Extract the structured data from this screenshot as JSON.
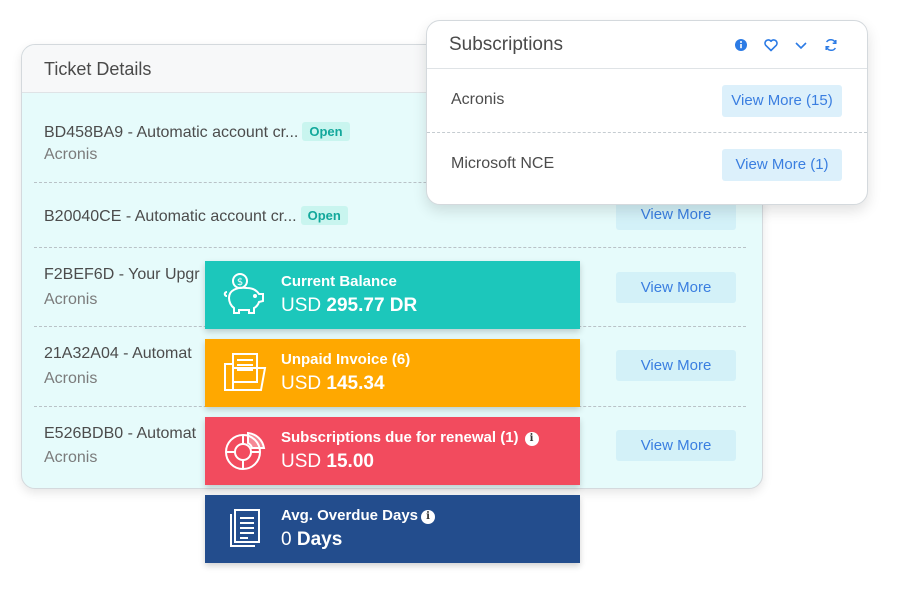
{
  "ticket_details": {
    "title": "Ticket Details",
    "rows": [
      {
        "title": "BD458BA9 - Automatic account cr...",
        "status": "Open",
        "product": "Acronis",
        "button": ""
      },
      {
        "title": "B20040CE - Automatic account cr...",
        "status": "Open",
        "product": "",
        "button": "View More"
      },
      {
        "title": "F2BEF6D - Your Upgr",
        "status": "",
        "product": "Acronis",
        "button": "View More"
      },
      {
        "title": "21A32A04 - Automat",
        "status": "",
        "product": "Acronis",
        "button": "View More"
      },
      {
        "title": "E526BDB0 - Automat",
        "status": "",
        "product": "Acronis",
        "button": "View More"
      }
    ]
  },
  "subscriptions": {
    "title": "Subscriptions",
    "icons": [
      "info-icon",
      "heart-icon",
      "chevron-down-icon",
      "refresh-icon"
    ],
    "rows": [
      {
        "name": "Acronis",
        "button": "View More (15)"
      },
      {
        "name": "Microsoft NCE",
        "button": "View More (1)"
      }
    ]
  },
  "stats": [
    {
      "label": "Current Balance",
      "currency": "USD",
      "value": "295.77 DR",
      "color": "#1cc7bb",
      "icon": "piggy-bank-icon"
    },
    {
      "label": "Unpaid Invoice (6)",
      "currency": "USD",
      "value": "145.34",
      "color": "#ffa800",
      "icon": "folder-documents-icon"
    },
    {
      "label": "Subscriptions due for renewal (1)",
      "currency": "USD",
      "value": "15.00",
      "color": "#f24b5e",
      "icon": "donut-chart-icon"
    },
    {
      "label": "Avg. Overdue Days",
      "currency": "0",
      "value": "Days",
      "color": "#234d8d",
      "icon": "document-list-icon"
    }
  ]
}
